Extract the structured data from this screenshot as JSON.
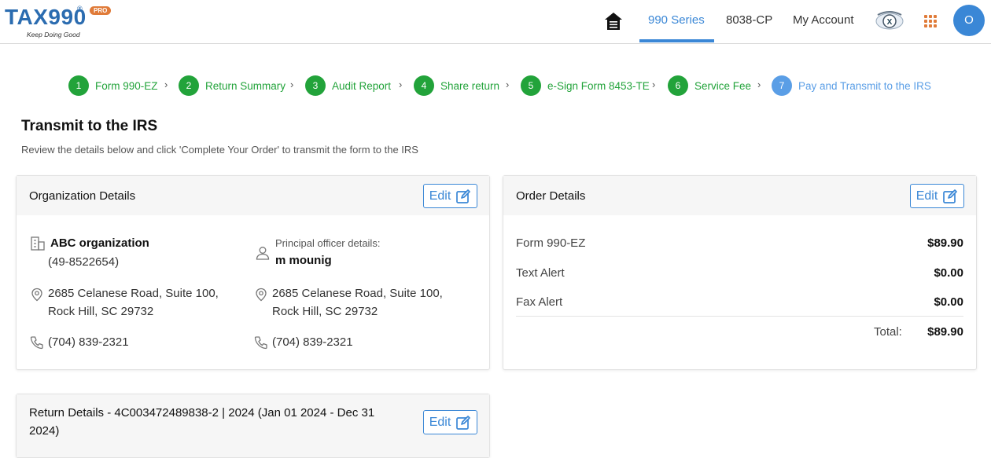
{
  "header": {
    "logo_text": "TAX990",
    "logo_reg": "®",
    "logo_badge": "PRO",
    "logo_tagline": "Keep Doing Good",
    "nav": [
      "990 Series",
      "8038-CP",
      "My Account"
    ],
    "avatar_initial": "O",
    "accent": "#3a87d6",
    "brand_orange": "#e07b39"
  },
  "stepper": {
    "separator": "›",
    "steps": [
      {
        "num": "1",
        "label": "Form 990-EZ",
        "status": "complete"
      },
      {
        "num": "2",
        "label": "Return Summary",
        "status": "complete"
      },
      {
        "num": "3",
        "label": "Audit Report",
        "status": "complete"
      },
      {
        "num": "4",
        "label": "Share return",
        "status": "complete"
      },
      {
        "num": "5",
        "label": "e-Sign Form 8453-TE",
        "status": "complete"
      },
      {
        "num": "6",
        "label": "Service Fee",
        "status": "complete"
      },
      {
        "num": "7",
        "label": "Pay and Transmit to the IRS",
        "status": "current"
      }
    ],
    "complete_color": "#22a33a",
    "current_color": "#5a9ee6"
  },
  "page": {
    "title": "Transmit to the IRS",
    "subtitle": "Review the details below and click 'Complete Your Order' to transmit the form to the IRS"
  },
  "organization": {
    "header": "Organization Details",
    "edit_label": "Edit",
    "name": "ABC organization",
    "ein": "(49-8522654)",
    "address_line1": "2685 Celanese Road, Suite 100,",
    "address_line2": "Rock Hill, SC 29732",
    "phone": "(704) 839-2321",
    "officer_caption": "Principal officer details:",
    "officer_name": "m mounig",
    "officer_address_line1": "2685 Celanese Road, Suite 100,",
    "officer_address_line2": "Rock Hill, SC 29732",
    "officer_phone": "(704) 839-2321"
  },
  "order": {
    "header": "Order Details",
    "edit_label": "Edit",
    "items": [
      {
        "label": "Form 990-EZ",
        "amount": "$89.90"
      },
      {
        "label": "Text Alert",
        "amount": "$0.00"
      },
      {
        "label": "Fax Alert",
        "amount": "$0.00"
      }
    ],
    "total_label": "Total:",
    "total_amount": "$89.90"
  },
  "return_details": {
    "header_line1": "Return Details - 4C003472489838-2 | 2024 (Jan 01 2024 - Dec 31",
    "header_line2": "2024)",
    "edit_label": "Edit"
  }
}
